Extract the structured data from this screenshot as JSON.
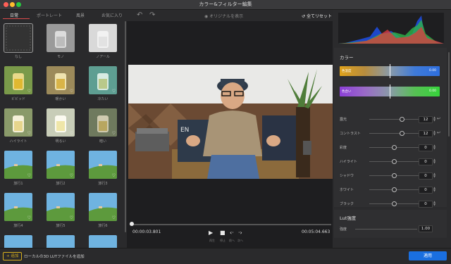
{
  "window": {
    "title": "カラー&フィルター編集"
  },
  "filters": {
    "tabs": [
      {
        "label": "日常",
        "active": true
      },
      {
        "label": "ポートレート",
        "active": false
      },
      {
        "label": "風景",
        "active": false
      },
      {
        "label": "お気に入り",
        "active": false
      }
    ],
    "items": [
      {
        "label": "なし",
        "style": "none",
        "selected": true,
        "fav": false
      },
      {
        "label": "モノ",
        "style": "mono",
        "selected": false,
        "fav": false
      },
      {
        "label": "ノアール",
        "style": "noir",
        "selected": false,
        "fav": false
      },
      {
        "label": "ビビッド",
        "style": "vivid",
        "selected": false,
        "fav": true
      },
      {
        "label": "暖かい",
        "style": "warm",
        "selected": false,
        "fav": true
      },
      {
        "label": "冷たい",
        "style": "cool",
        "selected": false,
        "fav": true
      },
      {
        "label": "ハイライト",
        "style": "highlight",
        "selected": false,
        "fav": true
      },
      {
        "label": "明るい",
        "style": "bright",
        "selected": false,
        "fav": true
      },
      {
        "label": "暗い",
        "style": "dark",
        "selected": false,
        "fav": true
      },
      {
        "label": "旅行1",
        "style": "travel",
        "selected": false,
        "fav": true
      },
      {
        "label": "旅行2",
        "style": "travel",
        "selected": false,
        "fav": true
      },
      {
        "label": "旅行3",
        "style": "travel",
        "selected": false,
        "fav": true
      },
      {
        "label": "旅行4",
        "style": "travel",
        "selected": false,
        "fav": true
      },
      {
        "label": "旅行5",
        "style": "travel",
        "selected": false,
        "fav": true
      },
      {
        "label": "旅行6",
        "style": "travel",
        "selected": false,
        "fav": true
      },
      {
        "label": "",
        "style": "travel",
        "selected": false,
        "fav": false
      },
      {
        "label": "",
        "style": "travel",
        "selected": false,
        "fav": false
      },
      {
        "label": "",
        "style": "travel",
        "selected": false,
        "fav": false
      }
    ]
  },
  "preview": {
    "show_original": "オリジナルを表示",
    "reset_all": "全てリセット",
    "current_time": "00:00:03.801",
    "total_time": "00:05:04.663",
    "progress": 0.01,
    "controls": {
      "play": "再生",
      "stop": "停止",
      "prev": "前へ",
      "next": "次へ"
    }
  },
  "color": {
    "section_title": "カラー",
    "temperature": {
      "label": "色温度",
      "value": "0.00"
    },
    "tint": {
      "label": "色合い",
      "value": "0.00"
    },
    "sliders": [
      {
        "label": "露光",
        "value": "12",
        "pos": 0.65,
        "reset": true
      },
      {
        "label": "コントラスト",
        "value": "12",
        "pos": 0.65,
        "reset": true
      },
      {
        "label": "彩度",
        "value": "0",
        "pos": 0.5,
        "reset": false
      },
      {
        "label": "ハイライト",
        "value": "0",
        "pos": 0.5,
        "reset": false
      },
      {
        "label": "シャドウ",
        "value": "0",
        "pos": 0.5,
        "reset": false
      },
      {
        "label": "ホワイト",
        "value": "0",
        "pos": 0.5,
        "reset": false
      },
      {
        "label": "ブラック",
        "value": "0",
        "pos": 0.5,
        "reset": false
      }
    ]
  },
  "lut": {
    "section_title": "Lut強度",
    "label": "強度",
    "value": "1.00"
  },
  "bottom": {
    "add_label": "追加",
    "add_hint": "ローカルの3D LUTファイルを追加",
    "apply_label": "適用"
  },
  "colors": {
    "accent": "#1a6fe0",
    "add_yellow": "#d9b11d",
    "tab_red": "#d94a4a"
  }
}
